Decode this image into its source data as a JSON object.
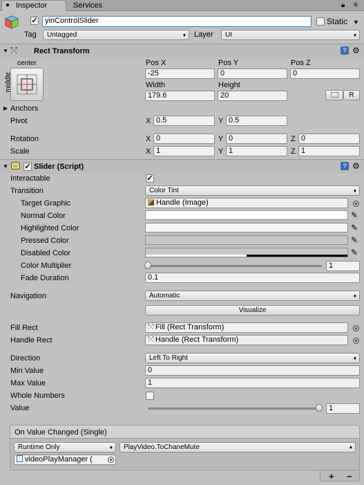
{
  "tabs": [
    {
      "label": "Inspector"
    },
    {
      "label": "Services"
    }
  ],
  "header": {
    "object_name": "yinControlSlider",
    "static_label": "Static",
    "tag_label": "Tag",
    "tag_value": "Untagged",
    "layer_label": "Layer",
    "layer_value": "UI"
  },
  "rect_transform": {
    "title": "Rect Transform",
    "anchor_h": "center",
    "anchor_v": "middle",
    "pos_x_label": "Pos X",
    "pos_x": "-25",
    "pos_y_label": "Pos Y",
    "pos_y": "0",
    "pos_z_label": "Pos Z",
    "pos_z": "0",
    "width_label": "Width",
    "width": "179.6",
    "height_label": "Height",
    "height": "20",
    "r_button": "R",
    "anchors_label": "Anchors",
    "pivot_label": "Pivot",
    "pivot_x": "0.5",
    "pivot_y": "0.5",
    "rotation_label": "Rotation",
    "rot_x": "0",
    "rot_y": "0",
    "rot_z": "0",
    "scale_label": "Scale",
    "scale_x": "1",
    "scale_y": "1",
    "scale_z": "1",
    "axis_x": "X",
    "axis_y": "Y",
    "axis_z": "Z"
  },
  "slider": {
    "title": "Slider (Script)",
    "interactable_label": "Interactable",
    "interactable_checked": true,
    "transition_label": "Transition",
    "transition_value": "Color Tint",
    "target_graphic_label": "Target Graphic",
    "target_graphic_value": "Handle (Image)",
    "normal_color_label": "Normal Color",
    "normal_color": "#ffffff",
    "highlighted_color_label": "Highlighted Color",
    "highlighted_color": "#f5f5f5",
    "pressed_color_label": "Pressed Color",
    "pressed_color": "#c8c8c8",
    "disabled_color_label": "Disabled Color",
    "disabled_color": "#c8c8c8",
    "color_multiplier_label": "Color Multiplier",
    "color_multiplier": "1",
    "fade_duration_label": "Fade Duration",
    "fade_duration": "0.1",
    "navigation_label": "Navigation",
    "navigation_value": "Automatic",
    "visualize_label": "Visualize",
    "fill_rect_label": "Fill Rect",
    "fill_rect_value": "Fill (Rect Transform)",
    "handle_rect_label": "Handle Rect",
    "handle_rect_value": "Handle (Rect Transform)",
    "direction_label": "Direction",
    "direction_value": "Left To Right",
    "min_value_label": "Min Value",
    "min_value": "0",
    "max_value_label": "Max Value",
    "max_value": "1",
    "whole_numbers_label": "Whole Numbers",
    "whole_numbers_checked": false,
    "value_label": "Value",
    "value": "1"
  },
  "event": {
    "title": "On Value Changed (Single)",
    "runtime_value": "Runtime Only",
    "function_value": "PlayVideo.ToChaneMute",
    "object_value": "videoPlayManager (",
    "add_label": "+",
    "remove_label": "−"
  },
  "icons": {
    "lock": "lock-icon",
    "menu": "menu-icon",
    "cube": "cube-icon",
    "help": "help-icon",
    "gear": "gear-icon",
    "script": "script-icon",
    "pipette": "pipette-icon",
    "object_picker": "object-picker-icon"
  }
}
